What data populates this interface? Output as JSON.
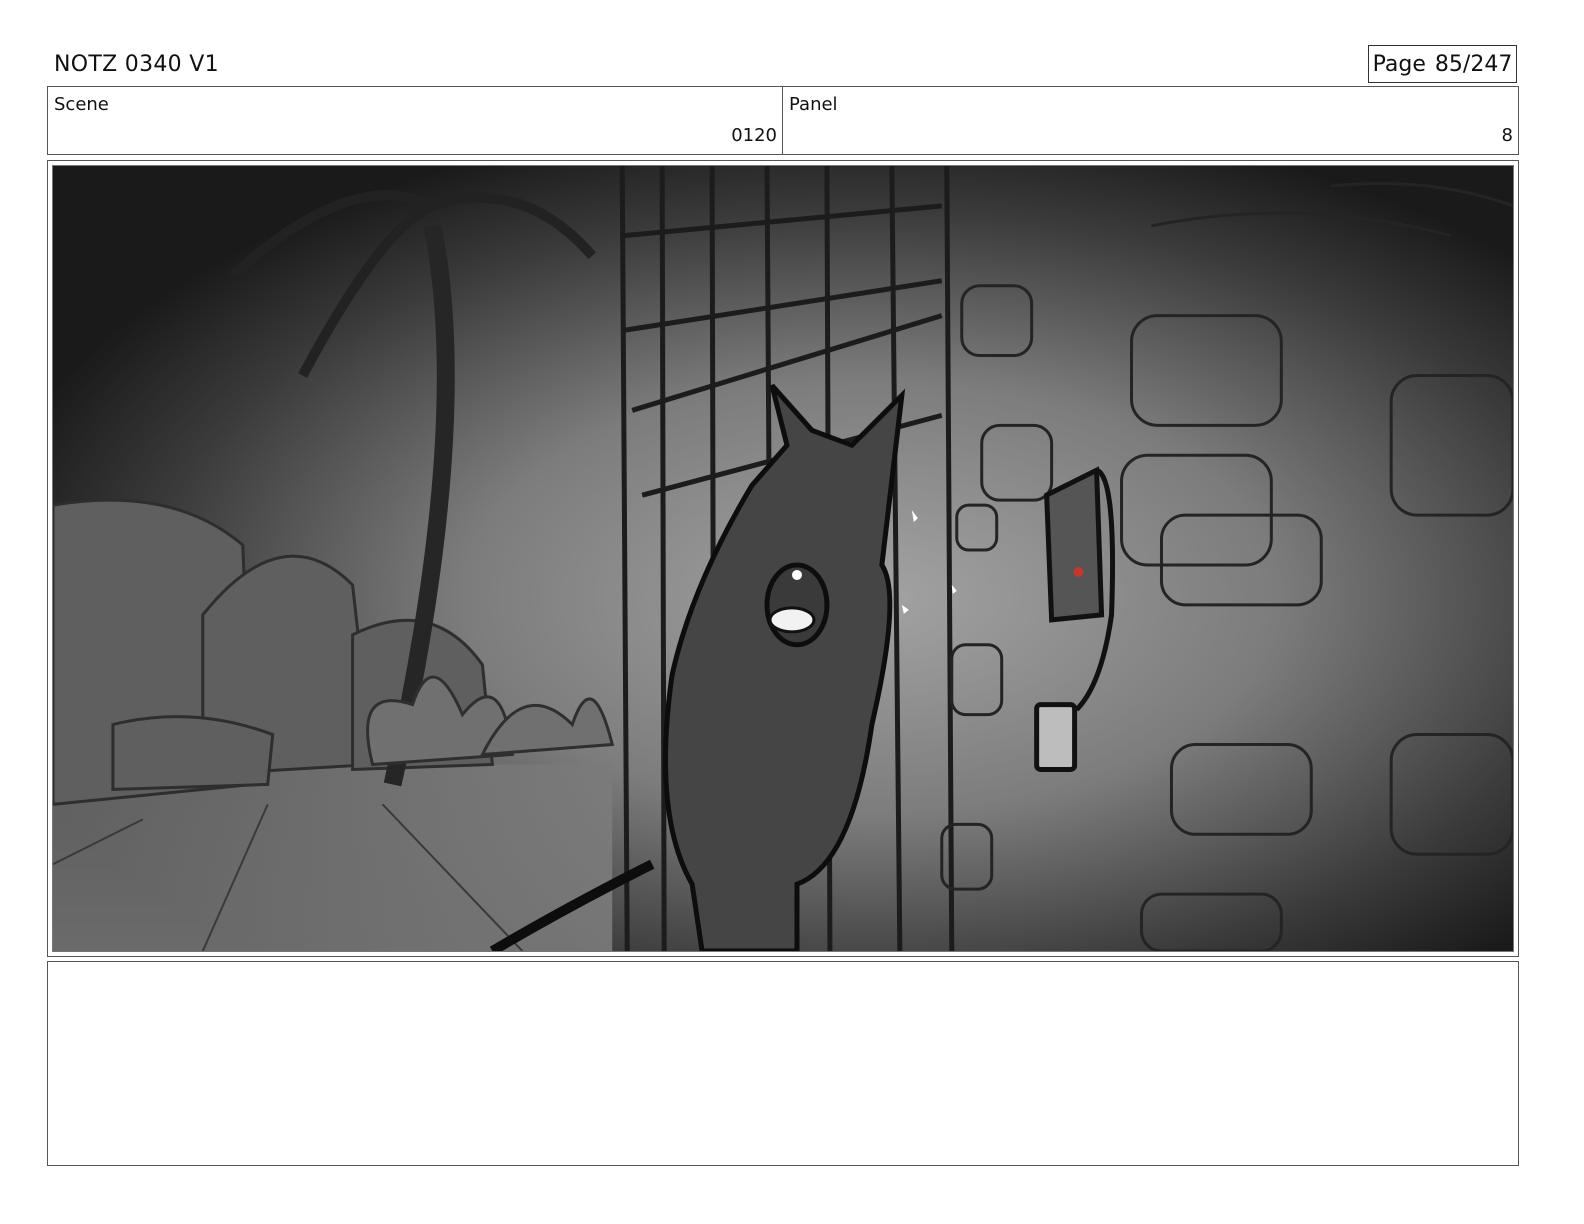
{
  "header": {
    "title": "NOTZ 0340 V1",
    "page_label": "Page",
    "page_number": "85/247"
  },
  "info": {
    "scene_label": "Scene",
    "scene_value": "0120",
    "panel_label": "Panel",
    "panel_value": "8"
  },
  "artwork": {
    "icon": "storyboard-sketch",
    "colors": {
      "background_dark": "#1a1a1a",
      "background_light": "#9a9a9a",
      "character": "#444444",
      "accent_red": "#c0392b"
    }
  },
  "notes": {
    "text": ""
  }
}
